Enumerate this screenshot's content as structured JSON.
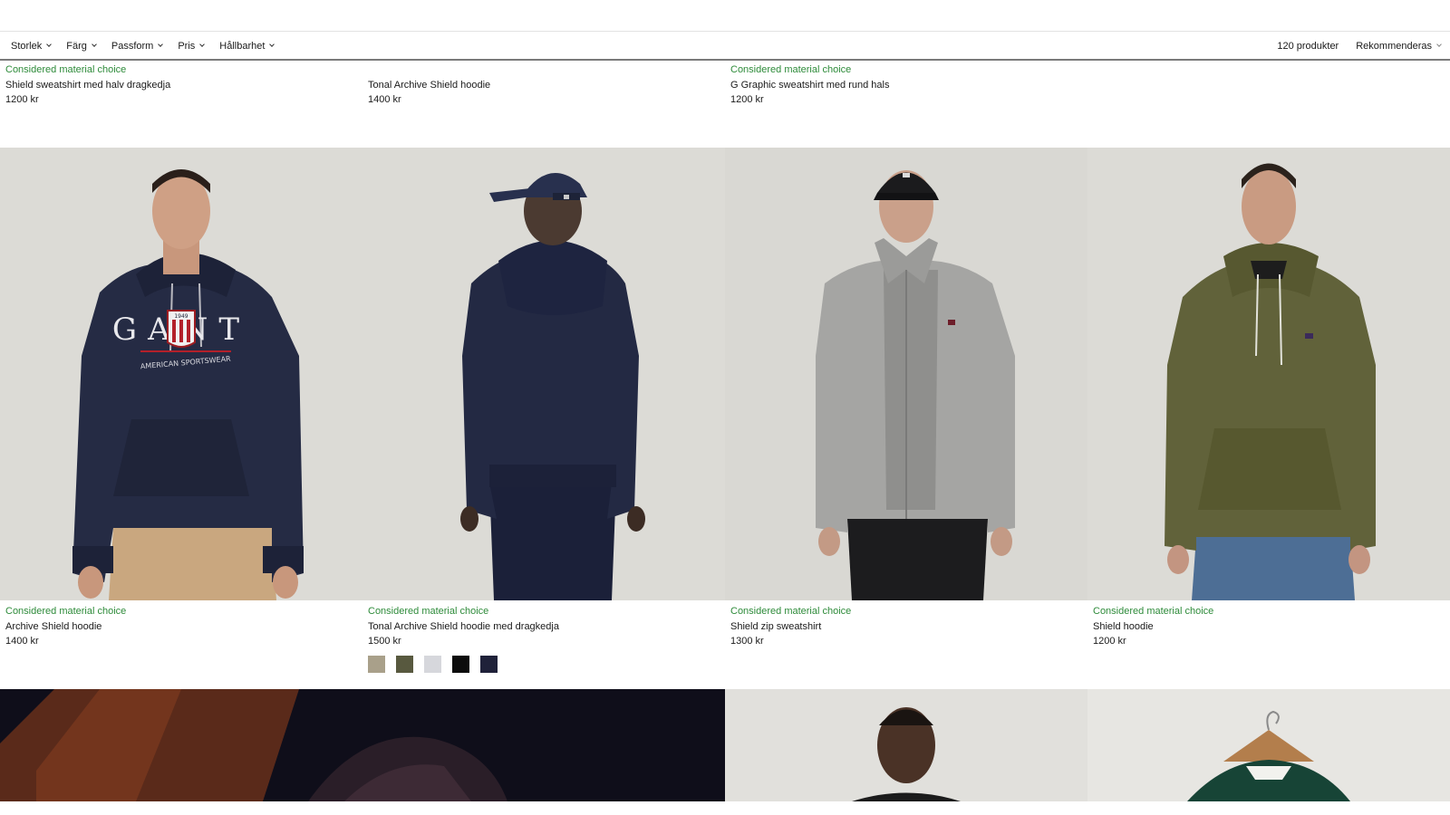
{
  "filters": [
    {
      "label": "Storlek"
    },
    {
      "label": "Färg"
    },
    {
      "label": "Passform"
    },
    {
      "label": "Pris"
    },
    {
      "label": "Hållbarhet"
    }
  ],
  "product_count": "120 produkter",
  "sort_label": "Rekommenderas",
  "top_row": [
    {
      "badge": "Considered material choice",
      "name": "Shield sweatshirt med halv dragkedja",
      "price": "1200 kr"
    },
    {
      "badge": "",
      "name": "Tonal Archive Shield hoodie",
      "price": "1400 kr"
    },
    {
      "badge": "Considered material choice",
      "name": "G Graphic sweatshirt med rund hals",
      "price": "1200 kr"
    }
  ],
  "products": [
    {
      "badge": "Considered material choice",
      "name": "Archive Shield hoodie",
      "price": "1400 kr",
      "garment_color": "#252b44",
      "pants_color": "#c9a77f"
    },
    {
      "badge": "Considered material choice",
      "name": "Tonal Archive Shield hoodie med dragkedja",
      "price": "1500 kr",
      "garment_color": "#232943",
      "pants_color": "#1b2039"
    },
    {
      "badge": "Considered material choice",
      "name": "Shield zip sweatshirt",
      "price": "1300 kr",
      "garment_color": "#a5a5a3",
      "pants_color": "#1c1c1e"
    },
    {
      "badge": "Considered material choice",
      "name": "Shield hoodie",
      "price": "1200 kr",
      "garment_color": "#61623a",
      "pants_color": "#4d6e95"
    }
  ],
  "logo": {
    "brand": "GANT",
    "year": "1949",
    "tagline": "AMERICAN SPORTSWEAR"
  },
  "swatches": [
    "#a9a08a",
    "#58593f",
    "#d6d7dc",
    "#0c0c0c",
    "#1f2139"
  ],
  "colors": {
    "badge_green": "#2e8b3a",
    "dark_banner": "#0f0e1a",
    "photo_background": "#d9d8d3"
  }
}
